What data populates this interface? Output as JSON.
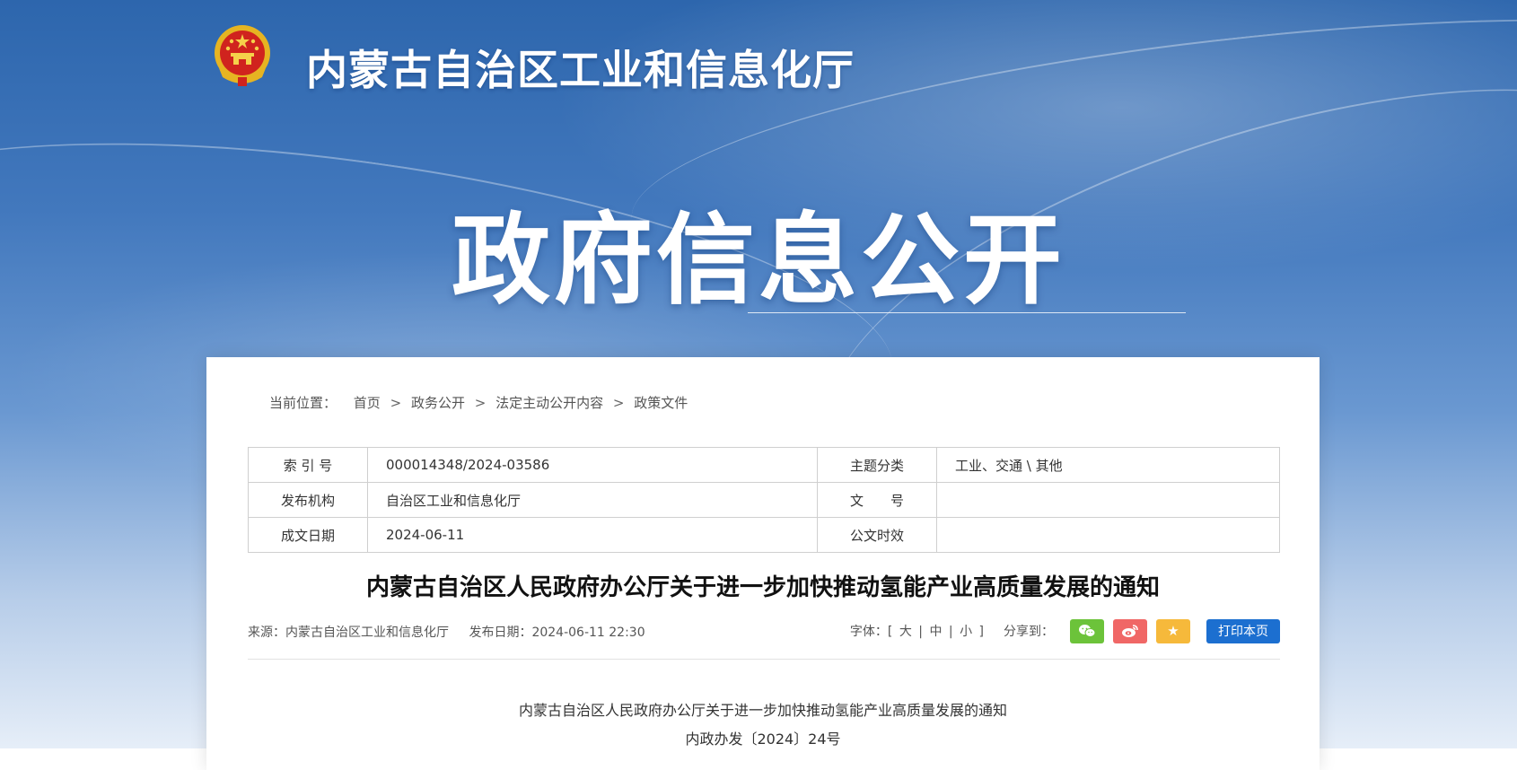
{
  "header": {
    "site_title": "内蒙古自治区工业和信息化厅",
    "banner_title": "政府信息公开",
    "emblem_icon": "national-emblem-icon"
  },
  "breadcrumb": {
    "lead": "当前位置：",
    "items": [
      "首页",
      "政务公开",
      "法定主动公开内容",
      "政策文件"
    ],
    "separator": ">"
  },
  "meta": {
    "index_label": "索 引 号",
    "index_value": "000014348/2024-03586",
    "topic_label": "主题分类",
    "topic_value": "工业、交通 \\ 其他",
    "org_label": "发布机构",
    "org_value": "自治区工业和信息化厅",
    "docno_label": "文　　号",
    "docno_value": "",
    "date_label": "成文日期",
    "date_value": "2024-06-11",
    "validity_label": "公文时效",
    "validity_value": ""
  },
  "article": {
    "title": "内蒙古自治区人民政府办公厅关于进一步加快推动氢能产业高质量发展的通知",
    "source": "来源：内蒙古自治区工业和信息化厅",
    "publish_date": "发布日期：2024-06-11 22:30",
    "body_title": "内蒙古自治区人民政府办公厅关于进一步加快推动氢能产业高质量发展的通知",
    "body_docno": "内政办发〔2024〕24号"
  },
  "tools": {
    "font_label": "字体：[",
    "font_large": "大",
    "font_medium": "中",
    "font_small": "小",
    "font_close": "]",
    "font_sep": "|",
    "share_label": "分享到：",
    "print_label": "打印本页",
    "wechat_icon": "wechat-icon",
    "weibo_icon": "weibo-icon",
    "favorite_icon": "star-icon"
  },
  "colors": {
    "banner_blue": "#2d66ad",
    "print_button": "#1c6fd0",
    "wechat_green": "#6cc33a",
    "weibo_red": "#f06766",
    "favorite_yellow": "#f6b93b"
  }
}
